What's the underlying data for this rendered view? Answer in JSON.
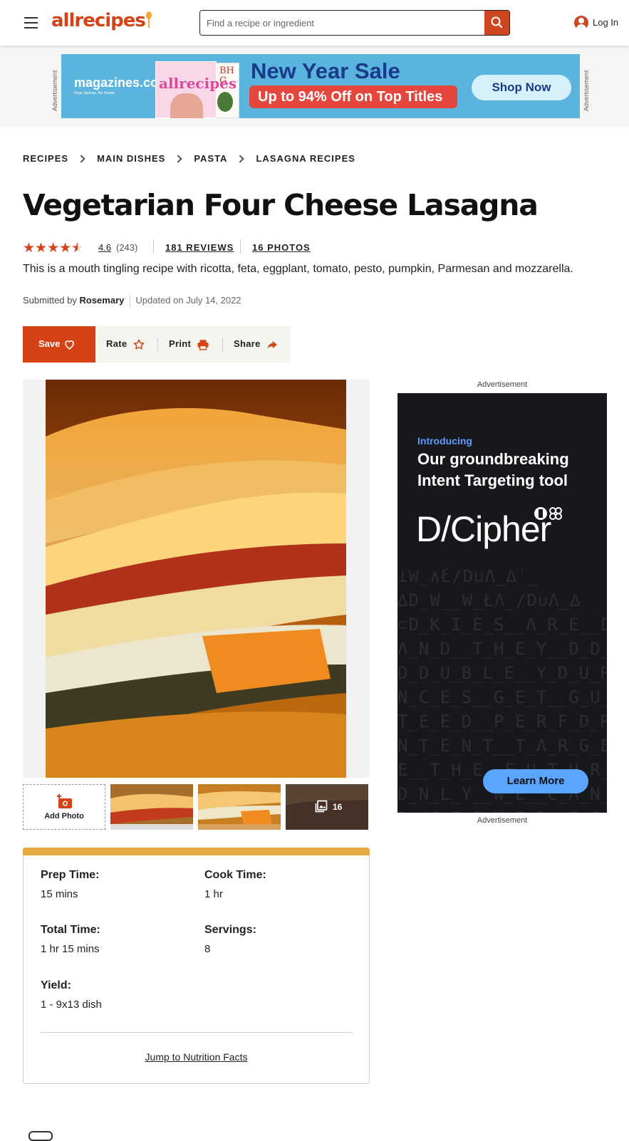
{
  "header": {
    "logo_text": "allrecipes",
    "search_placeholder": "Find a recipe or ingredient",
    "login_label": "Log In",
    "brand_color": "#d54215"
  },
  "top_ad": {
    "side_label": "Advertisement",
    "brand": "magazines.com",
    "brand_tagline": "Huge Savings. No Hassle.",
    "cover1_title": "allrecipes",
    "cover2_title": "BH G",
    "headline": "New Year Sale",
    "offer": "Up to 94% Off on Top Titles",
    "cta": "Shop Now"
  },
  "breadcrumbs": [
    "RECIPES",
    "MAIN DISHES",
    "PASTA",
    "LASAGNA RECIPES"
  ],
  "recipe": {
    "title": "Vegetarian Four Cheese Lasagna",
    "rating_value": "4.6",
    "rating_count": "(243)",
    "stars": 4.6,
    "reviews_link": "181 REVIEWS",
    "photos_link": "16 PHOTOS",
    "description": "This is a mouth tingling recipe with ricotta, feta, eggplant, tomato, pesto, pumpkin, Parmesan and mozzarella.",
    "submitted_prefix": "Submitted by",
    "author": "Rosemary",
    "updated": "Updated on July 14, 2022"
  },
  "actions": {
    "save": "Save",
    "rate": "Rate",
    "print": "Print",
    "share": "Share"
  },
  "gallery": {
    "add_photo": "Add Photo",
    "more_count": "16"
  },
  "details": [
    {
      "label": "Prep Time:",
      "value": "15 mins"
    },
    {
      "label": "Cook Time:",
      "value": "1 hr"
    },
    {
      "label": "Total Time:",
      "value": "1 hr 15 mins"
    },
    {
      "label": "Servings:",
      "value": "8"
    },
    {
      "label": "Yield:",
      "value": "1 - 9x13 dish"
    }
  ],
  "jump_link": "Jump to Nutrition Facts",
  "side_ad": {
    "label_top": "Advertisement",
    "label_bottom": "Advertisement",
    "intro": "Introducing",
    "headline_1": "Our groundbreaking",
    "headline_2": "Intent Targeting tool",
    "brand": "D/Cipher",
    "cta": "Learn More"
  }
}
